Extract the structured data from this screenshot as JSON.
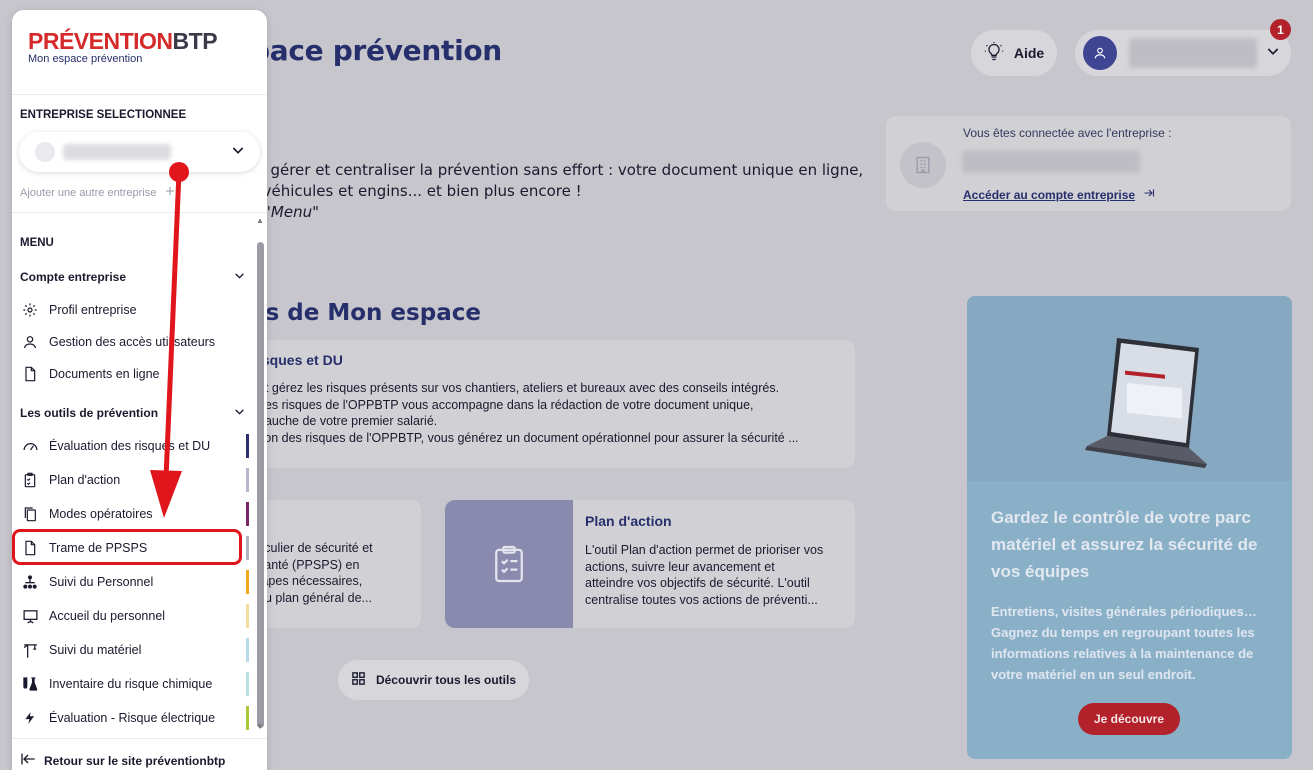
{
  "header": {
    "title": "pace prévention",
    "help_label": "Aide",
    "notification_count": "1"
  },
  "intro": {
    "line1": "ur gérer et centraliser la prévention sans effort : votre document unique en ligne,",
    "line2": "s véhicules et engins... et bien plus encore !",
    "line3": "e \"Menu\""
  },
  "company_card": {
    "label": "Vous êtes connectée avec l'entreprise :",
    "link": "Accéder au compte entreprise"
  },
  "section": {
    "title": "és de Mon espace"
  },
  "tools": {
    "risks": {
      "title": "isques et DU",
      "lines": [
        "et gérez les risques présents sur vos chantiers, ateliers et bureaux avec des conseils intégrés.",
        "des risques de l'OPPBTP vous accompagne dans la rédaction de votre document unique,",
        "bauche de votre premier salarié.",
        "tion des risques de l'OPPBTP, vous générez un document opérationnel pour assurer la sécurité ..."
      ]
    },
    "ppsps": {
      "lines": [
        "ticulier de sécurité et",
        "santé (PPSPS) en",
        "tapes nécessaires,",
        "du plan général de..."
      ]
    },
    "action_plan": {
      "title": "Plan d'action",
      "lines": [
        "L'outil Plan d'action permet de prioriser vos",
        "actions, suivre leur avancement et",
        "atteindre vos objectifs de sécurité. L'outil",
        "centralise toutes vos actions de préventi..."
      ]
    },
    "discover_label": "Découvrir tous les outils"
  },
  "promo": {
    "heading": "Gardez le contrôle de votre parc matériel et assurez la sécurité de vos équipes",
    "body_lines": [
      "Entretiens, visites générales périodiques…",
      "Gagnez du temps en regroupant toutes les",
      "informations relatives à la maintenance de",
      "votre matériel en un seul endroit."
    ],
    "cta": "Je découvre"
  },
  "sidebar": {
    "brand_red": "PRÉVENTION",
    "brand_dark": "BTP",
    "brand_sub": "Mon espace prévention",
    "enterprise_label": "ENTREPRISE SELECTIONNEE",
    "add_enterprise": "Ajouter une autre entreprise",
    "menu_label": "MENU",
    "group_account": "Compte entreprise",
    "account_items": [
      "Profil entreprise",
      "Gestion des accès utilisateurs",
      "Documents en ligne"
    ],
    "group_tools": "Les outils de prévention",
    "tool_items": [
      {
        "label": "Évaluation des risques et DU",
        "icon": "gauge-icon",
        "color": "#2b2f6e"
      },
      {
        "label": "Plan d'action",
        "icon": "checklist-icon",
        "color": "#b7b6cc"
      },
      {
        "label": "Modes opératoires",
        "icon": "copy-icon",
        "color": "#7b2669"
      },
      {
        "label": "Trame de PPSPS",
        "icon": "document-icon",
        "color": "#b3b3bd"
      },
      {
        "label": "Suivi du Personnel",
        "icon": "org-chart-icon",
        "color": "#f2a81d"
      },
      {
        "label": "Accueil du personnel",
        "icon": "presentation-icon",
        "color": "#f4dc9a"
      },
      {
        "label": "Suivi du matériel",
        "icon": "crane-icon",
        "color": "#b5dbe8"
      },
      {
        "label": "Inventaire du risque chimique",
        "icon": "flask-icon",
        "color": "#b9e1df"
      },
      {
        "label": "Évaluation - Risque électrique",
        "icon": "lightning-icon",
        "color": "#a9c93a"
      }
    ],
    "back_link": "Retour sur le site préventionbtp"
  },
  "colors": {
    "accent_red": "#b3222b",
    "brand_navy": "#262f6b",
    "annotation_red": "#e0161c"
  }
}
